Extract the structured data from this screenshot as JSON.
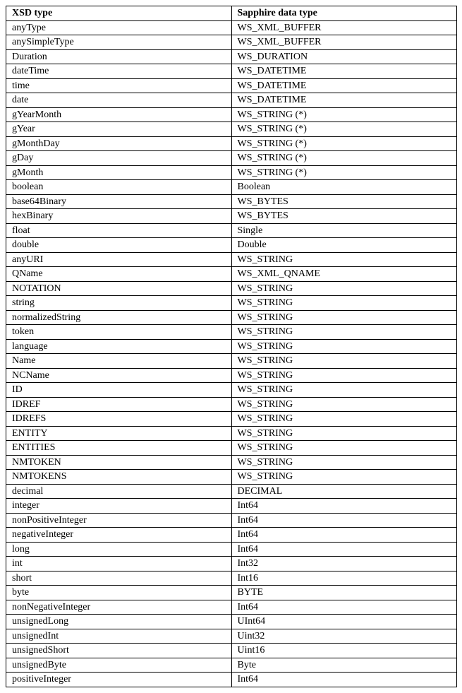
{
  "table": {
    "headers": [
      "XSD type",
      "Sapphire data type"
    ],
    "rows": [
      [
        "anyType",
        "WS_XML_BUFFER"
      ],
      [
        "anySimpleType",
        "WS_XML_BUFFER"
      ],
      [
        "Duration",
        "WS_DURATION"
      ],
      [
        "dateTime",
        "WS_DATETIME"
      ],
      [
        "time",
        "WS_DATETIME"
      ],
      [
        "date",
        "WS_DATETIME"
      ],
      [
        "gYearMonth",
        "WS_STRING (*)"
      ],
      [
        "gYear",
        "WS_STRING (*)"
      ],
      [
        "gMonthDay",
        "WS_STRING (*)"
      ],
      [
        "gDay",
        "WS_STRING (*)"
      ],
      [
        "gMonth",
        "WS_STRING (*)"
      ],
      [
        "boolean",
        "Boolean"
      ],
      [
        "base64Binary",
        "WS_BYTES"
      ],
      [
        "hexBinary",
        " WS_BYTES"
      ],
      [
        "float",
        "Single"
      ],
      [
        "double",
        "Double"
      ],
      [
        "anyURI",
        "WS_STRING"
      ],
      [
        "QName",
        "WS_XML_QNAME"
      ],
      [
        "NOTATION",
        "WS_STRING"
      ],
      [
        "string",
        "WS_STRING"
      ],
      [
        "normalizedString",
        "WS_STRING"
      ],
      [
        "token",
        "WS_STRING"
      ],
      [
        "language",
        "WS_STRING"
      ],
      [
        "Name",
        "WS_STRING"
      ],
      [
        "NCName",
        "WS_STRING"
      ],
      [
        "ID",
        "WS_STRING"
      ],
      [
        "IDREF",
        "WS_STRING"
      ],
      [
        "IDREFS",
        "WS_STRING"
      ],
      [
        "ENTITY",
        "WS_STRING"
      ],
      [
        "ENTITIES",
        "WS_STRING"
      ],
      [
        "NMTOKEN",
        "WS_STRING"
      ],
      [
        "NMTOKENS",
        "WS_STRING"
      ],
      [
        "decimal",
        "DECIMAL"
      ],
      [
        "integer",
        "Int64"
      ],
      [
        "nonPositiveInteger",
        "Int64"
      ],
      [
        "negativeInteger",
        "Int64"
      ],
      [
        "long",
        "Int64"
      ],
      [
        "int",
        "Int32"
      ],
      [
        "short",
        "Int16"
      ],
      [
        "byte",
        "BYTE"
      ],
      [
        "nonNegativeInteger",
        "Int64"
      ],
      [
        "unsignedLong",
        "UInt64"
      ],
      [
        "unsignedInt",
        "Uint32"
      ],
      [
        "unsignedShort",
        "Uint16"
      ],
      [
        "unsignedByte",
        "Byte"
      ],
      [
        "positiveInteger",
        "Int64"
      ]
    ]
  }
}
